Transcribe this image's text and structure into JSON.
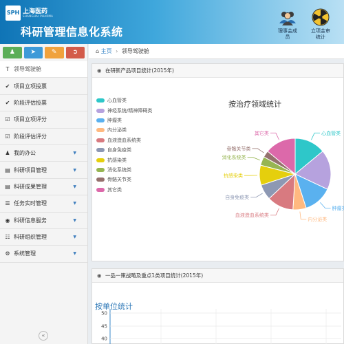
{
  "header": {
    "logo_text": "SPH",
    "logo_cn": "上海医药",
    "logo_en": "SHANGHAI PHARMA",
    "system_title": "科研管理信息化系统",
    "buttons": [
      {
        "label_line1": "理事会成",
        "label_line2": "员",
        "icon": "users-icon"
      },
      {
        "label_line1": "立项金审",
        "label_line2": "统计",
        "icon": "radiation-icon"
      }
    ]
  },
  "sidebar": {
    "action_buttons": [
      {
        "icon": "user-icon",
        "color": "#5cae58"
      },
      {
        "icon": "send-icon",
        "color": "#3e9ad8"
      },
      {
        "icon": "edit-icon",
        "color": "#f0a23d"
      },
      {
        "icon": "logout-icon",
        "color": "#d35b4a"
      }
    ],
    "items": [
      {
        "label": "领导驾驶舱",
        "icon": "text-icon",
        "active": true
      },
      {
        "label": "项目立项投票",
        "icon": "check-circle-icon"
      },
      {
        "label": "阶段评估投票",
        "icon": "check-circle-icon"
      },
      {
        "label": "项目立项评分",
        "icon": "checkbox-icon"
      },
      {
        "label": "阶段评估评分",
        "icon": "checkbox-icon"
      },
      {
        "label": "我的办公",
        "icon": "user-icon",
        "expandable": true
      },
      {
        "label": "科研项目管理",
        "icon": "folder-icon",
        "expandable": true
      },
      {
        "label": "科研成果管理",
        "icon": "folder-icon",
        "expandable": true
      },
      {
        "label": "任务实时管理",
        "icon": "list-icon",
        "expandable": true
      },
      {
        "label": "科研信息服务",
        "icon": "globe-icon",
        "expandable": true
      },
      {
        "label": "科研组织管理",
        "icon": "sitemap-icon",
        "expandable": true
      },
      {
        "label": "系统管理",
        "icon": "cogs-icon",
        "expandable": true
      }
    ],
    "collapse_icon": "«"
  },
  "breadcrumb": {
    "home": "主页",
    "separator": "›",
    "current": "领导驾驶舱"
  },
  "panel1": {
    "title": "在研新产品项目统计(2015年)"
  },
  "panel2": {
    "title": "一品一策战略及重点1类项目统计(2015年)"
  },
  "chart_data": [
    {
      "type": "pie",
      "title": "按治疗领域统计",
      "legend_position": "left",
      "categories": [
        "心血管类",
        "神经系统/精神障碍类",
        "肿瘤类",
        "内分泌类",
        "血液造血系统类",
        "自身免疫类",
        "抗感染类",
        "消化系统类",
        "骨骼关节类",
        "其它类"
      ],
      "values": [
        14,
        18,
        13,
        6,
        12,
        7,
        9,
        4,
        3,
        14
      ],
      "colors": [
        "#2ec7c9",
        "#b6a2de",
        "#5ab1ef",
        "#ffb980",
        "#d87a80",
        "#8d98b3",
        "#e5cf0d",
        "#97b552",
        "#95706d",
        "#dc69aa"
      ],
      "slice_labels": [
        "心血管类",
        "",
        "肿瘤类",
        "内分泌类",
        "血液造血系统类",
        "自身免疫类",
        "抗感染类",
        "消化系统类",
        "骨骼关节类",
        "其它类"
      ]
    },
    {
      "type": "bar",
      "title": "按单位统计",
      "y_ticks": [
        "50",
        "45",
        "40"
      ]
    }
  ]
}
